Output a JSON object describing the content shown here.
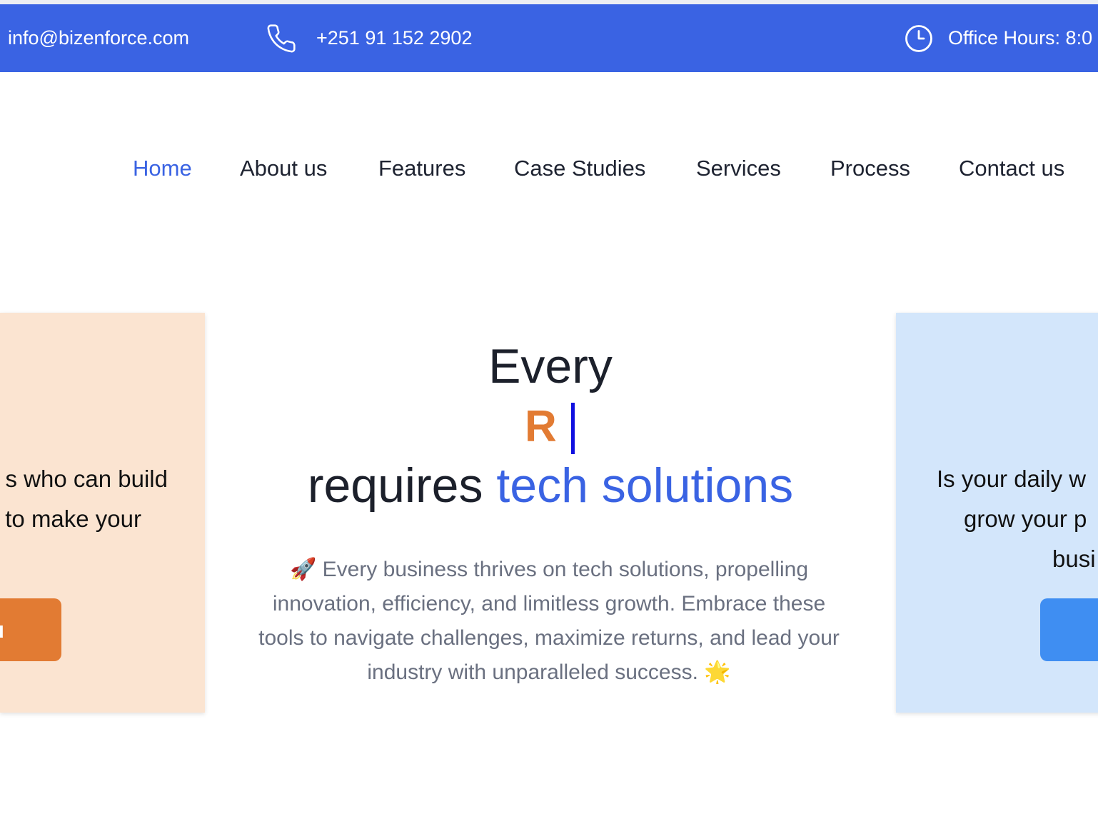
{
  "topbar": {
    "email": "info@bizenforce.com",
    "phone": "+251 91 152 2902",
    "hours": "Office Hours: 8:0",
    "icons": {
      "phone": "phone-icon",
      "hours": "clock-icon"
    },
    "background_color": "#3a63e3"
  },
  "nav": {
    "items": [
      {
        "label": "Home",
        "active": true
      },
      {
        "label": "About us"
      },
      {
        "label": "Features"
      },
      {
        "label": "Case Studies"
      },
      {
        "label": "Services"
      },
      {
        "label": "Process"
      },
      {
        "label": "Contact us"
      }
    ],
    "active_color": "#3a63e3"
  },
  "left_card": {
    "line1": "s who can build",
    "line2": "to make your",
    "button_label": "u",
    "background_color": "#fbe4d1",
    "button_color": "#e27b33"
  },
  "right_card": {
    "line1": "Is your daily w",
    "line2": "grow your p",
    "line3": "busi",
    "background_color": "#d3e6fb",
    "button_color": "#3f8ef2"
  },
  "hero": {
    "line1": "Every",
    "typed_text": "R",
    "line3_prefix": "requires ",
    "line3_highlight": "tech solutions",
    "description": "🚀 Every business thrives on tech solutions, propelling innovation, efficiency, and limitless growth. Embrace these tools to navigate challenges, maximize returns, and lead your industry with unparalleled success. 🌟",
    "typed_color": "#e27b33",
    "highlight_color": "#3a63e3"
  }
}
